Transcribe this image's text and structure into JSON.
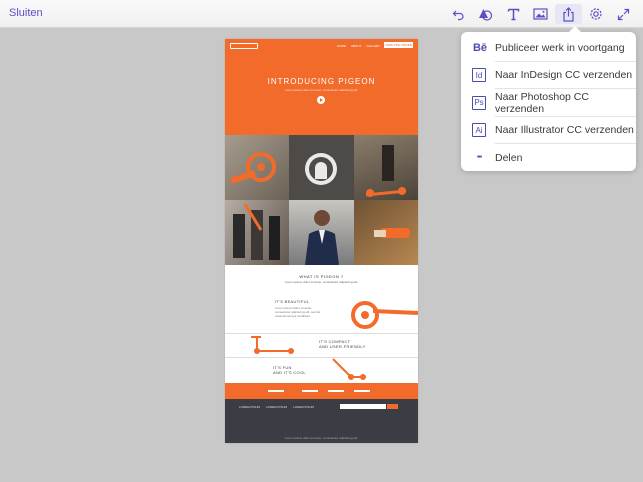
{
  "topbar": {
    "close_label": "Sluiten",
    "tools": [
      "undo-icon",
      "shapes-icon",
      "text-icon",
      "image-icon",
      "share-icon",
      "gear-icon",
      "expand-icon"
    ],
    "accent_color": "#5a4fc4"
  },
  "artboard": {
    "hero": {
      "nav": [
        "HOME",
        "ABOUT",
        "GALLERY"
      ],
      "nav_button": "FREE PRE-ORDER",
      "title": "INTRODUCING PIGEON",
      "subtitle": "Lorem ipsum dolor sit amet, consectetur adipiscing elit."
    },
    "what": {
      "title": "WHAT IS PIGEON ?",
      "subtitle": "Lorem ipsum dolor sit amet, consectetur adipiscing elit."
    },
    "features": [
      {
        "line1": "IT'S BEAUTIFUL",
        "line2": "",
        "text": "Lorem ipsum dolor sit amet, consectetur adipiscing elit, sed do eiusmod tempor incididunt."
      },
      {
        "line1": "IT'S COMPACT",
        "line2": "AND USER-FRIENDLY",
        "text": ""
      },
      {
        "line1": "IT'S FUN",
        "line2": "AND IT'S COOL",
        "text": ""
      }
    ],
    "footer": {
      "links": [
        "LOREM IPSUM",
        "LOREM IPSUM",
        "LOREM IPSUM"
      ],
      "copy": "Lorem ipsum dolor sit amet, consectetur adipiscing elit."
    },
    "brand_color": "#f26b2b"
  },
  "share_menu": {
    "items": [
      {
        "icon": "behance-icon",
        "glyph": "Bē",
        "label": "Publiceer werk in voortgang"
      },
      {
        "icon": "indesign-icon",
        "glyph": "Id",
        "label": "Naar InDesign CC verzenden"
      },
      {
        "icon": "photoshop-icon",
        "glyph": "Ps",
        "label": "Naar Photoshop CC verzenden"
      },
      {
        "icon": "illustrator-icon",
        "glyph": "Ai",
        "label": "Naar Illustrator CC verzenden"
      },
      {
        "icon": "more-icon",
        "glyph": "•••",
        "label": "Delen"
      }
    ]
  }
}
